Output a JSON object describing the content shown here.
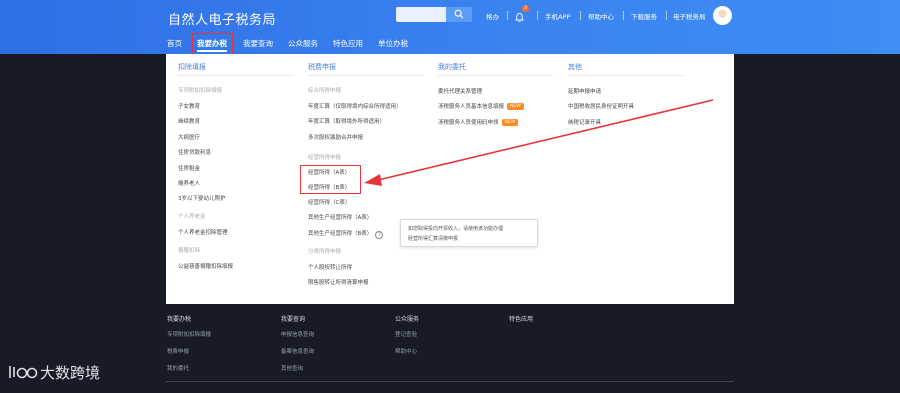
{
  "header": {
    "logo": "自然人电子税务局",
    "links": {
      "help_icon_label": "格办",
      "mobile_app": "手机APP",
      "help_center": "帮助中心",
      "download": "下载服务",
      "tax_bureau": "电子税务局"
    },
    "bell_badge": "3"
  },
  "nav": {
    "items": [
      "首页",
      "我要办税",
      "我要查询",
      "公众服务",
      "特色应用",
      "单位办税"
    ]
  },
  "panel": {
    "col1": {
      "title": "扣除填报",
      "sub1": "专项附加扣除填报",
      "items1": [
        "子女教育",
        "继续教育",
        "大病医疗",
        "住房贷款利息",
        "住房租金",
        "赡养老人",
        "3岁以下婴幼儿照护"
      ],
      "sub2": "个人养老金",
      "items2": [
        "个人养老金扣除管理"
      ],
      "sub3": "捐赠扣除",
      "items3": [
        "公益慈善捐赠扣除填报"
      ]
    },
    "col2": {
      "title": "税费申报",
      "sub1": "综合所得申报",
      "items1": [
        "年度汇算（仅取得境内综合所得适用）",
        "年度汇算（取得境外所得适用）",
        "多次股权激励合并申报"
      ],
      "sub2": "经营所得申报",
      "items2": [
        "经营所得（A表）",
        "经营所得（B表）",
        "经营所得（C表）",
        "其他生产经营所得（A表）",
        "其他生产经营所得（B表）"
      ],
      "sub3": "分类所得申报",
      "items3": [
        "个人股权转让所得",
        "限售股转让所得清算申报"
      ]
    },
    "col3": {
      "title": "我的委托",
      "items": [
        "委托代理关系管理",
        "涉税服务人员基本信息填报",
        "涉税服务人员使用码申领"
      ],
      "new_tag": "NEW"
    },
    "col4": {
      "title": "其他",
      "items": [
        "延期申报申请",
        "中国税收居民身份证明开具",
        "纳税记录开具"
      ]
    },
    "tooltip": {
      "line1": "如您取得投向开票收入，请使用该功能办理",
      "line2": "经营所得汇算清缴申报"
    }
  },
  "footer": {
    "titles": [
      "我要办税",
      "我要查询",
      "公众服务",
      "特色应用"
    ],
    "col1": [
      "专项附加扣除填报",
      "税费申报",
      "我的委托"
    ],
    "col2": [
      "申报信息查询",
      "备案信息查询",
      "其他查询"
    ],
    "col3": [
      "登记查验",
      "帮助中心"
    ]
  },
  "watermark": {
    "text": "大数跨境"
  },
  "colors": {
    "header_blue": "#3b84f0",
    "highlight_red": "#e8353b",
    "footer_bg": "#161b26",
    "new_orange": "#ff8a1f"
  }
}
